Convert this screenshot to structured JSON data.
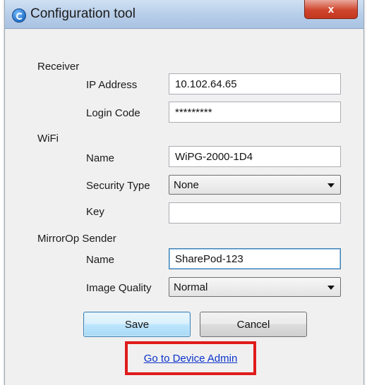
{
  "window": {
    "title": "Configuration tool",
    "close_label": "x"
  },
  "receiver": {
    "section_label": "Receiver",
    "ip_label": "IP Address",
    "ip_value": "10.102.64.65",
    "login_label": "Login Code",
    "login_value": "*********"
  },
  "wifi": {
    "section_label": "WiFi",
    "name_label": "Name",
    "name_value": "WiPG-2000-1D4",
    "security_label": "Security Type",
    "security_value": "None",
    "key_label": "Key",
    "key_value": ""
  },
  "sender": {
    "section_label": "MirrorOp Sender",
    "name_label": "Name",
    "name_value": "SharePod-123",
    "quality_label": "Image Quality",
    "quality_value": "Normal"
  },
  "buttons": {
    "save_label": "Save",
    "cancel_label": "Cancel"
  },
  "admin_link": {
    "label": "Go to Device Admin"
  },
  "colors": {
    "highlight_box": "#e01b1b",
    "link": "#0b33c9",
    "focus_border": "#3c7fb1"
  }
}
